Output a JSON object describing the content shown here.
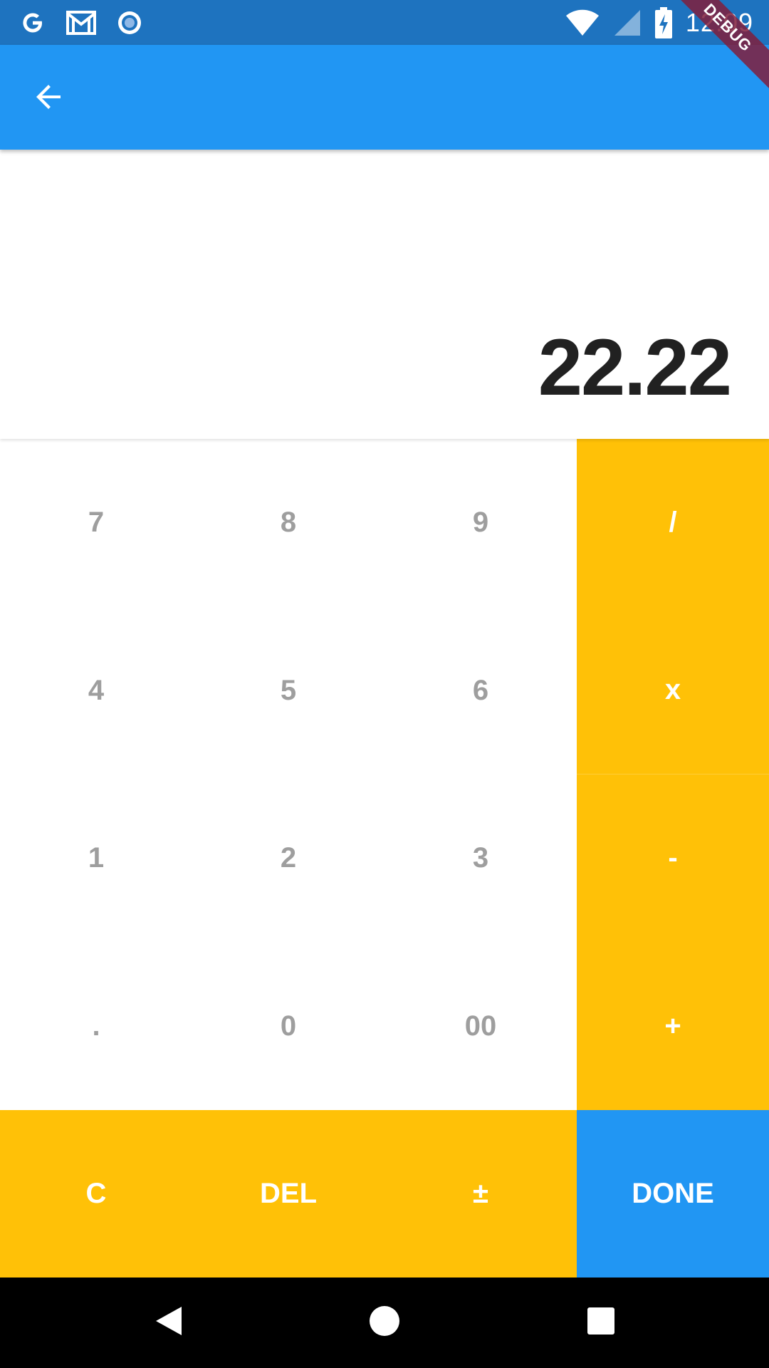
{
  "status_bar": {
    "time": "12:09",
    "left_icons": [
      "google-icon",
      "gmail-icon",
      "location-target-icon"
    ],
    "right_icons": [
      "wifi-icon",
      "cell-signal-icon",
      "battery-charging-icon"
    ]
  },
  "debug_banner": "DEBUG",
  "app_bar": {
    "back_icon": "arrow-back-icon"
  },
  "display": {
    "value": "22.22"
  },
  "keypad": {
    "rows": [
      [
        "7",
        "8",
        "9"
      ],
      [
        "4",
        "5",
        "6"
      ],
      [
        "1",
        "2",
        "3"
      ],
      [
        ".",
        "0",
        "00"
      ]
    ],
    "operators": [
      "/",
      "x",
      "-",
      "+"
    ],
    "bottom": [
      "C",
      "DEL",
      "±"
    ],
    "done": "DONE"
  },
  "colors": {
    "status_bar": "#1e73bf",
    "app_bar": "#2196f3",
    "operator_keys": "#ffc107",
    "done_key": "#2196f3",
    "number_text": "#9e9e9e"
  },
  "nav_bar": {
    "icons": [
      "back-triangle-icon",
      "home-circle-icon",
      "recents-square-icon"
    ]
  }
}
